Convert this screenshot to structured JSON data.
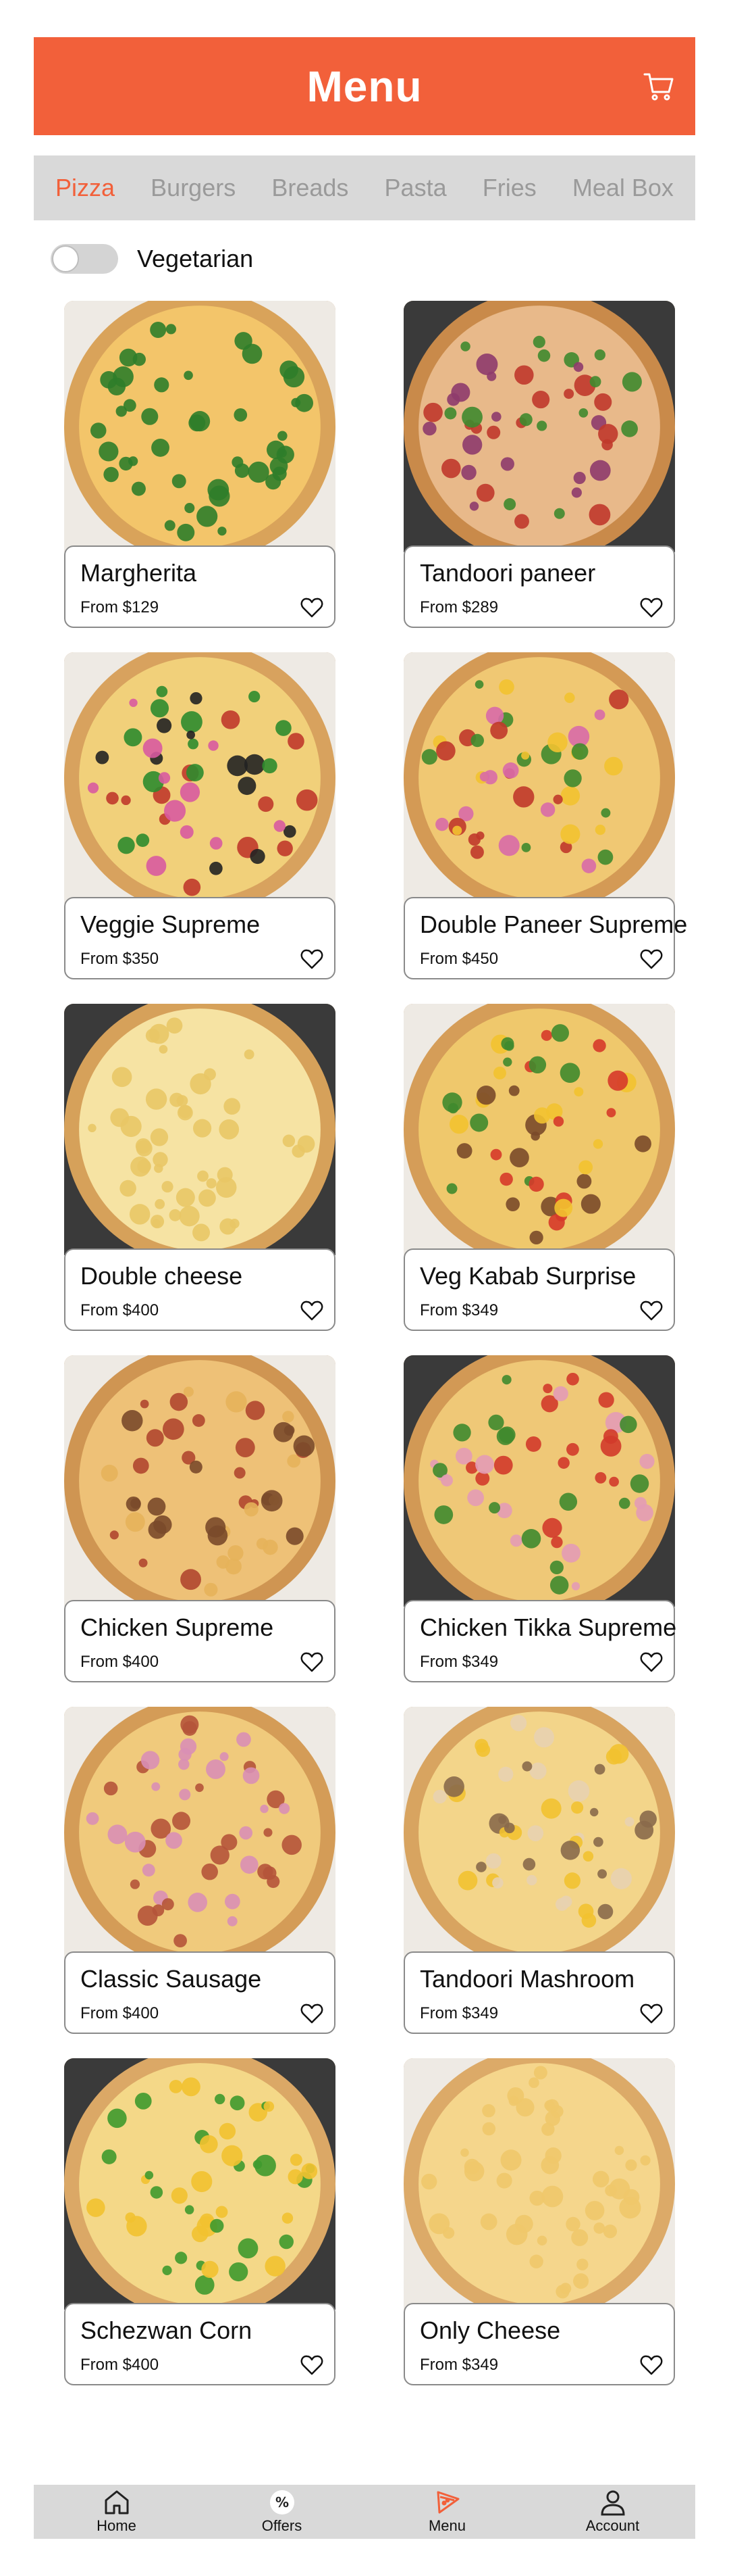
{
  "header": {
    "title": "Menu",
    "cart_icon": "cart-icon",
    "color": "#f2603a"
  },
  "tabs": [
    {
      "label": "Pizza",
      "active": true
    },
    {
      "label": "Burgers",
      "active": false
    },
    {
      "label": "Breads",
      "active": false
    },
    {
      "label": "Pasta",
      "active": false
    },
    {
      "label": "Fries",
      "active": false
    },
    {
      "label": "Meal Box",
      "active": false
    }
  ],
  "filter": {
    "label": "Vegetarian",
    "on": false
  },
  "items": [
    {
      "name": "Margherita",
      "price": "From $129"
    },
    {
      "name": "Tandoori paneer",
      "price": "From $289"
    },
    {
      "name": "Veggie Supreme",
      "price": "From $350"
    },
    {
      "name": "Double Paneer Supreme",
      "price": "From $450"
    },
    {
      "name": "Double cheese",
      "price": "From $400"
    },
    {
      "name": "Veg Kabab Surprise",
      "price": "From $349"
    },
    {
      "name": "Chicken Supreme",
      "price": "From $400"
    },
    {
      "name": "Chicken Tikka Supreme",
      "price": "From $349"
    },
    {
      "name": "Classic Sausage",
      "price": "From $400"
    },
    {
      "name": "Tandoori Mashroom",
      "price": "From $349"
    },
    {
      "name": "Schezwan Corn",
      "price": "From $400"
    },
    {
      "name": "Only Cheese",
      "price": "From $349"
    }
  ],
  "nav": [
    {
      "label": "Home",
      "icon": "home-icon"
    },
    {
      "label": "Offers",
      "icon": "offers-icon"
    },
    {
      "label": "Menu",
      "icon": "menu-icon"
    },
    {
      "label": "Account",
      "icon": "account-icon"
    }
  ]
}
